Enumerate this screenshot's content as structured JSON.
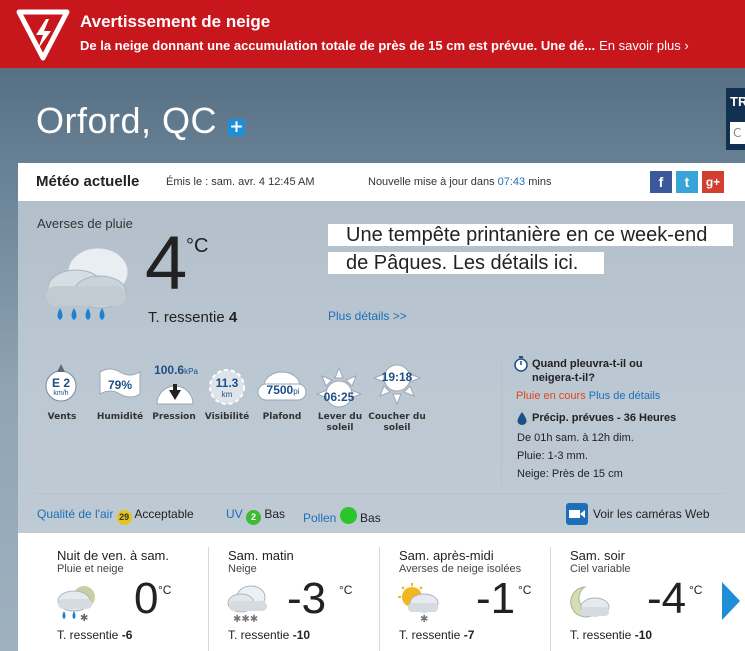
{
  "alert": {
    "title": "Avertissement de neige",
    "text": "De la neige donnant une accumulation totale de près de 15 cm est prévue. Une dé...",
    "more": "En savoir plus ›"
  },
  "location": {
    "city": "Orford, QC",
    "add_label": "+"
  },
  "side_panel": {
    "label": "TR",
    "input_value": "C"
  },
  "current": {
    "title": "Météo actuelle",
    "issued": "Émis le : sam. avr. 4 12:45 AM",
    "update_prefix": "Nouvelle mise à jour dans",
    "update_time": "07:43",
    "update_suffix": "mins",
    "condition": "Averses de pluie",
    "temp": "4",
    "temp_unit": "°C",
    "feels_label": "T. ressentie",
    "feels_value": "4",
    "story": "Une tempête printanière en ce week-end de Pâques. Les détails ici.",
    "more_details": "Plus détails >>",
    "social": {
      "facebook": "f",
      "twitter": "t",
      "googleplus": "g+"
    }
  },
  "stats": {
    "wind": {
      "value": "E 2",
      "unit": "km/h",
      "label": "Vents"
    },
    "humidity": {
      "value": "79%",
      "label": "Humidité"
    },
    "pressure": {
      "value": "100.6",
      "unit": "kPa",
      "label": "Pression"
    },
    "visibility": {
      "value": "11.3",
      "unit": "km",
      "label": "Visibilité"
    },
    "ceiling": {
      "value": "7500",
      "unit": "pi",
      "label": "Plafond"
    },
    "sunrise": {
      "value": "06:25",
      "label": "Lever du soleil"
    },
    "sunset": {
      "value": "19:18",
      "label": "Coucher du soleil"
    }
  },
  "rain_query": {
    "question": "Quand pleuvra-t-il ou neigera-t-il?",
    "status": "Pluie en cours",
    "details_link": "Plus de détails",
    "precip_title": "Précip. prévues - 36 Heures",
    "period": "De 01h sam. à 12h dim.",
    "rain": "Pluie: 1-3 mm.",
    "snow": "Neige: Près de 15 cm"
  },
  "air": {
    "aq_label": "Qualité de l'air",
    "aq_value": "29",
    "aq_text": "Acceptable",
    "uv_label": "UV",
    "uv_value": "2",
    "uv_text": "Bas",
    "pollen_label": "Pollen",
    "pollen_text": "Bas",
    "webcams": "Voir les caméras Web"
  },
  "forecast": [
    {
      "title": "Nuit de ven. à sam.",
      "sub": "Pluie et neige",
      "temp": "0",
      "unit": "°C",
      "feels_label": "T. ressentie",
      "feels_value": "-6",
      "icon": "rain-snow-night-icon"
    },
    {
      "title": "Sam. matin",
      "sub": "Neige",
      "temp": "-3",
      "unit": "°C",
      "feels_label": "T. ressentie",
      "feels_value": "-10",
      "icon": "snow-icon"
    },
    {
      "title": "Sam. après-midi",
      "sub": "Averses de neige isolées",
      "temp": "-1",
      "unit": "°C",
      "feels_label": "T. ressentie",
      "feels_value": "-7",
      "icon": "sun-snow-icon"
    },
    {
      "title": "Sam. soir",
      "sub": "Ciel variable",
      "temp": "-4",
      "unit": "°C",
      "feels_label": "T. ressentie",
      "feels_value": "-10",
      "icon": "moon-cloud-icon"
    }
  ],
  "colors": {
    "alert": "#c8161d",
    "link": "#1e6fb8",
    "accent": "#1e8ed6",
    "aq_badge": "#e5c51a",
    "uv_badge": "#3dbb32",
    "pollen_badge": "#29c629"
  }
}
